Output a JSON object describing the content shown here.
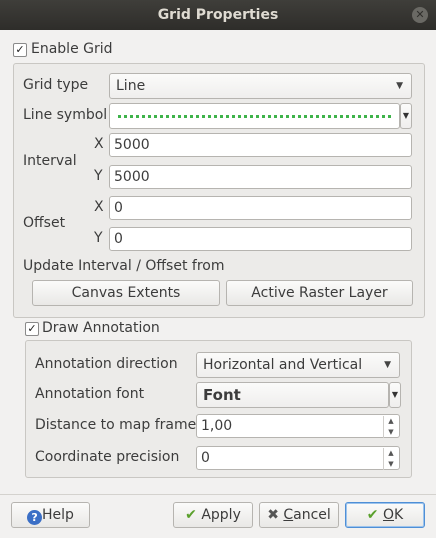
{
  "window": {
    "title": "Grid Properties"
  },
  "enable_grid": {
    "label": "Enable Grid",
    "checked": true,
    "check_glyph": "✓"
  },
  "grid_type": {
    "label": "Grid type",
    "value": "Line"
  },
  "line_symbol": {
    "label": "Line symbol",
    "color": "#3eb34a",
    "style": "dotted"
  },
  "interval": {
    "label": "Interval",
    "x_label": "X",
    "x_value": "5000",
    "y_label": "Y",
    "y_value": "5000"
  },
  "offset": {
    "label": "Offset",
    "x_label": "X",
    "x_value": "0",
    "y_label": "Y",
    "y_value": "0"
  },
  "update_from": {
    "label": "Update Interval / Offset from",
    "canvas_extents": "Canvas Extents",
    "active_raster_layer": "Active Raster Layer"
  },
  "draw_annotation": {
    "label": "Draw Annotation",
    "checked": true,
    "check_glyph": "✓"
  },
  "annotation_direction": {
    "label": "Annotation direction",
    "value": "Horizontal and Vertical"
  },
  "annotation_font": {
    "label": "Annotation font",
    "value": "Font"
  },
  "distance_to_map_frame": {
    "label": "Distance to map frame",
    "value": "1,00"
  },
  "coordinate_precision": {
    "label": "Coordinate precision",
    "value": "0"
  },
  "buttons": {
    "help": "Help",
    "apply": "Apply",
    "cancel_prefix": "",
    "cancel_underlined": "C",
    "cancel_rest": "ancel",
    "ok_underlined": "O",
    "ok_rest": "K"
  },
  "icons": {
    "close": "close-icon",
    "help": "help-icon",
    "apply": "checkmark-icon",
    "cancel": "cross-icon",
    "ok": "checkmark-icon"
  },
  "colors": {
    "accent": "#4f8fd6",
    "help_icon": "#3b6fc6",
    "check_green": "#5aa02c",
    "cancel_red": "#555555"
  }
}
